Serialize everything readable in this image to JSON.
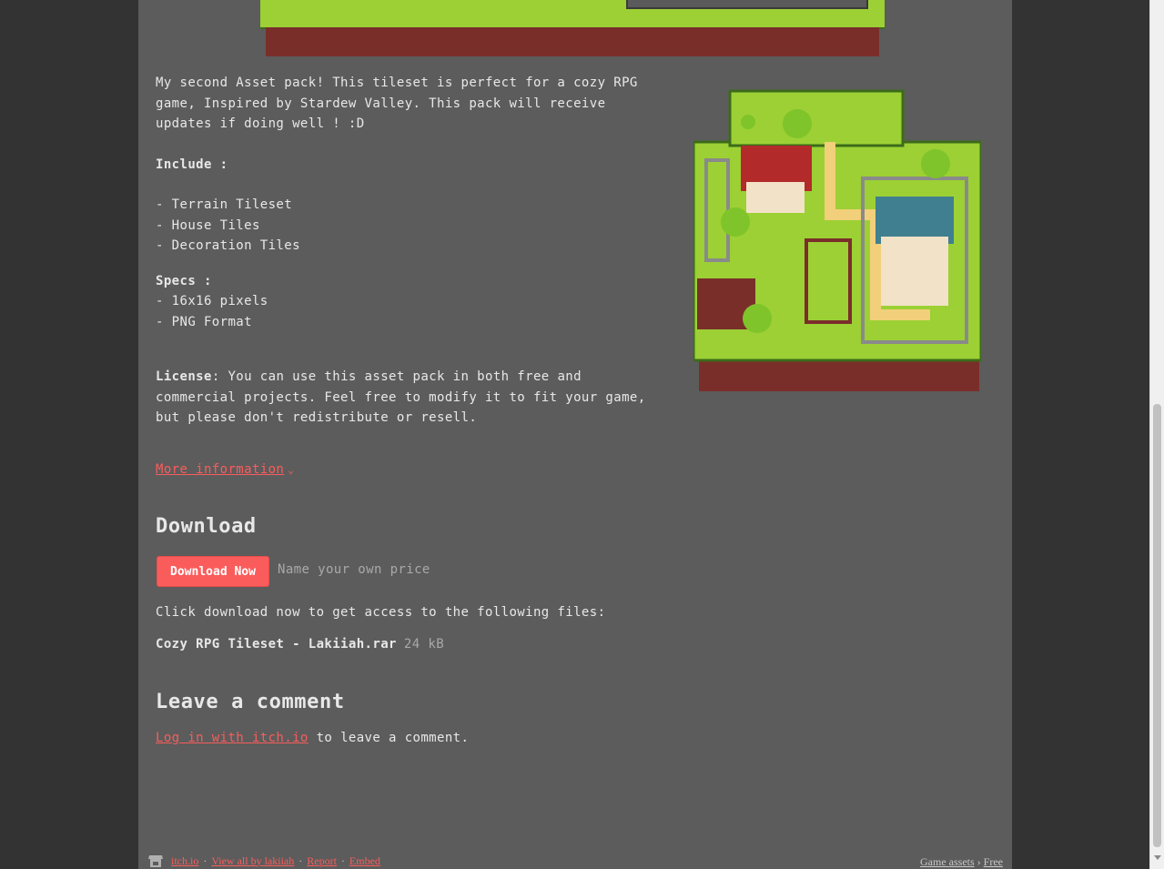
{
  "description": {
    "intro": "My second Asset pack! This tileset is perfect for a cozy RPG game, Inspired by Stardew Valley. This pack will receive updates if doing well ! :D",
    "include_heading": "Include :",
    "include_items": [
      "- Terrain Tileset",
      "- House Tiles",
      "- Decoration Tiles"
    ],
    "specs_heading": "Specs :",
    "specs_items": [
      "- 16x16 pixels",
      "- PNG Format"
    ],
    "license_label": "License",
    "license_text": ": You can use this asset pack in both free and commercial projects. Feel free to modify it to fit your game, but please don't redistribute or resell."
  },
  "more_info": {
    "label": "More information"
  },
  "download": {
    "heading": "Download",
    "button_label": "Download Now",
    "price_note": "Name your own price",
    "files_intro": "Click download now to get access to the following files:",
    "file_name": "Cozy RPG Tileset - Lakiiah.rar",
    "file_size": "24 kB"
  },
  "comments": {
    "heading": "Leave a comment",
    "login_link": "Log in with itch.io",
    "login_suffix": " to leave a comment."
  },
  "footer": {
    "links": [
      "itch.io",
      "View all by lakiiah",
      "Report",
      "Embed"
    ],
    "separator": "·",
    "breadcrumb": [
      "Game assets",
      "Free"
    ],
    "breadcrumb_sep": "›"
  },
  "colors": {
    "page_bg": "#5c5c5c",
    "outer_bg": "#333333",
    "accent": "#fa5c5c",
    "text": "#e8e8e8",
    "muted": "#a8a8a8"
  }
}
